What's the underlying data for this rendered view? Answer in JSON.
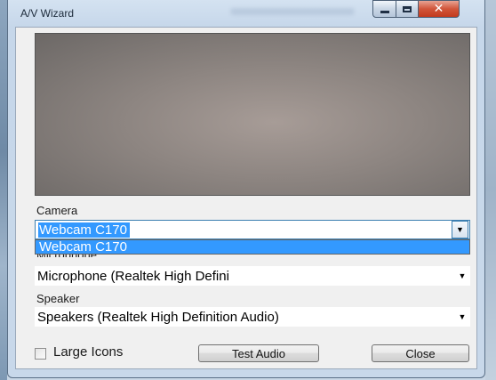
{
  "window": {
    "title": "A/V Wizard",
    "minimize_icon": "minimize-icon",
    "maximize_icon": "maximize-icon",
    "close_icon": "close-icon",
    "close_glyph": "✕"
  },
  "camera": {
    "label": "Camera",
    "selected": "Webcam C170",
    "options": [
      "Webcam C170"
    ],
    "dropdown_open": true
  },
  "microphone": {
    "label": "Microphone",
    "selected": "Microphone (Realtek High Defini"
  },
  "speaker": {
    "label": "Speaker",
    "selected": "Speakers (Realtek High Definition Audio)"
  },
  "options": {
    "large_icons_label": "Large Icons",
    "large_icons_checked": false
  },
  "buttons": {
    "test_audio": "Test Audio",
    "close": "Close"
  },
  "colors": {
    "selection": "#3399ff",
    "title_bar": "#c6d7ea",
    "close_button": "#c9452a"
  }
}
